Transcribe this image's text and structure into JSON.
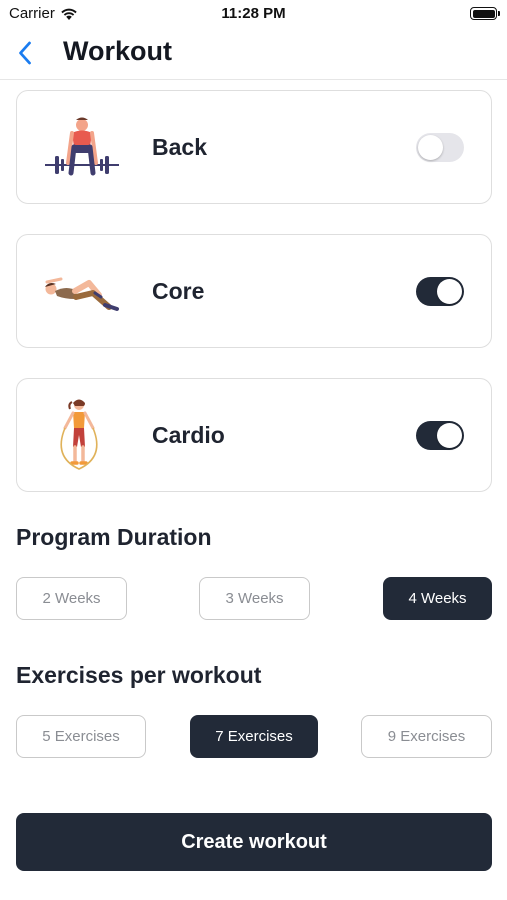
{
  "status_bar": {
    "carrier": "Carrier",
    "time": "11:28 PM"
  },
  "nav": {
    "title": "Workout",
    "back_icon": "chevron-left-icon"
  },
  "colors": {
    "primary": "#222a38",
    "toggle_off": "#e5e5ea",
    "back_accent": "#1a7cf0"
  },
  "workout_types": [
    {
      "label": "Back",
      "illustration": "deadlift-illustration",
      "enabled": false
    },
    {
      "label": "Core",
      "illustration": "crunch-illustration",
      "enabled": true
    },
    {
      "label": "Cardio",
      "illustration": "jump-rope-illustration",
      "enabled": true
    }
  ],
  "program_duration": {
    "title": "Program Duration",
    "options": [
      "2 Weeks",
      "3 Weeks",
      "4 Weeks"
    ],
    "selected": "4 Weeks"
  },
  "exercises_per_workout": {
    "title": "Exercises per workout",
    "options": [
      "5 Exercises",
      "7 Exercises",
      "9 Exercises"
    ],
    "selected": "7 Exercises"
  },
  "create_button": {
    "label": "Create workout"
  }
}
